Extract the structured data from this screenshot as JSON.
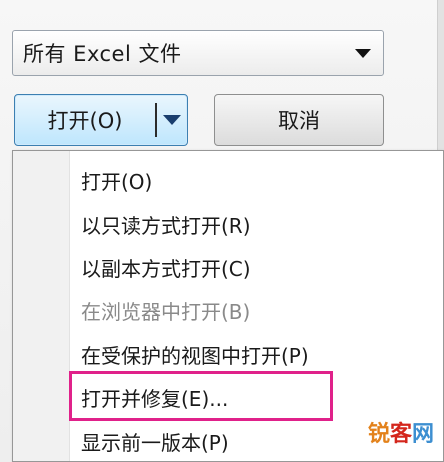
{
  "dialog": {
    "filetype": {
      "value": "所有 Excel 文件"
    },
    "open_button": {
      "label": "打开(O)"
    },
    "cancel_button": {
      "label": "取消"
    }
  },
  "menu": {
    "items": [
      {
        "label": "打开(O)",
        "enabled": true
      },
      {
        "label": "以只读方式打开(R)",
        "enabled": true
      },
      {
        "label": "以副本方式打开(C)",
        "enabled": true
      },
      {
        "label": "在浏览器中打开(B)",
        "enabled": false
      },
      {
        "label": "在受保护的视图中打开(P)",
        "enabled": true
      },
      {
        "label": "打开并修复(E)...",
        "enabled": true,
        "highlighted": true
      },
      {
        "label": "显示前一版本(P)",
        "enabled": true
      }
    ]
  },
  "colors": {
    "highlight_border": "#e0218a",
    "button_accent": "#3c7fb1"
  },
  "watermark": {
    "part1": "锐",
    "part2": "客",
    "part3": "网"
  }
}
